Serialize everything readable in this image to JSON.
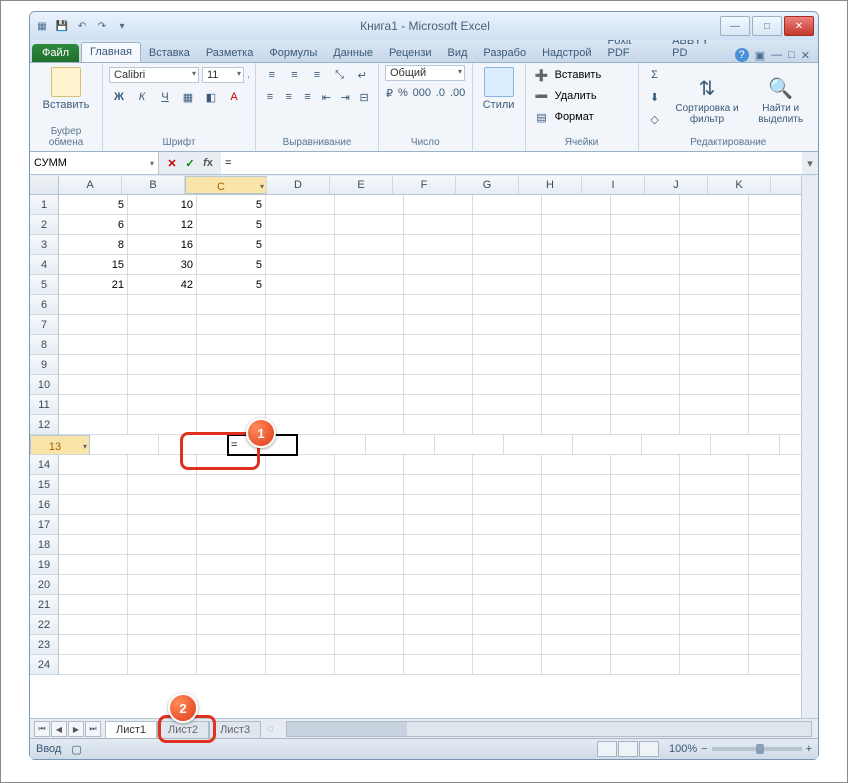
{
  "window": {
    "title": "Книга1 - Microsoft Excel"
  },
  "qat": {
    "save": "💾",
    "undo": "↶",
    "redo": "↷",
    "more": "▾"
  },
  "file_tab": "Файл",
  "ribbon_tabs": [
    "Главная",
    "Вставка",
    "Разметка",
    "Формулы",
    "Данные",
    "Рецензи",
    "Вид",
    "Разрабо",
    "Надстрой",
    "Foxit PDF",
    "ABBYY PD"
  ],
  "active_tab": 0,
  "groups": {
    "clipboard": {
      "title": "Буфер обмена",
      "paste": "Вставить"
    },
    "font": {
      "title": "Шрифт",
      "name": "Calibri",
      "size": "11"
    },
    "align": {
      "title": "Выравнивание"
    },
    "number": {
      "title": "Число",
      "format": "Общий"
    },
    "styles": {
      "title": "",
      "btn": "Стили"
    },
    "cells": {
      "title": "Ячейки",
      "insert": "Вставить",
      "delete": "Удалить",
      "format": "Формат"
    },
    "edit": {
      "title": "Редактирование",
      "sort": "Сортировка и фильтр",
      "find": "Найти и выделить"
    }
  },
  "namebox": "СУММ",
  "formula": "=",
  "columns": [
    "A",
    "B",
    "C",
    "D",
    "E",
    "F",
    "G",
    "H",
    "I",
    "J",
    "K"
  ],
  "active_col": 2,
  "row_count": 24,
  "active_row": 13,
  "cells": {
    "A1": "5",
    "B1": "10",
    "C1": "5",
    "A2": "6",
    "B2": "12",
    "C2": "5",
    "A3": "8",
    "B3": "16",
    "C3": "5",
    "A4": "15",
    "B4": "30",
    "C4": "5",
    "A5": "21",
    "B5": "42",
    "C5": "5",
    "C13": "="
  },
  "badges": {
    "b1": "1",
    "b2": "2"
  },
  "sheets": [
    "Лист1",
    "Лист2",
    "Лист3"
  ],
  "active_sheet": 0,
  "status": {
    "mode": "Ввод",
    "zoom": "100%"
  }
}
